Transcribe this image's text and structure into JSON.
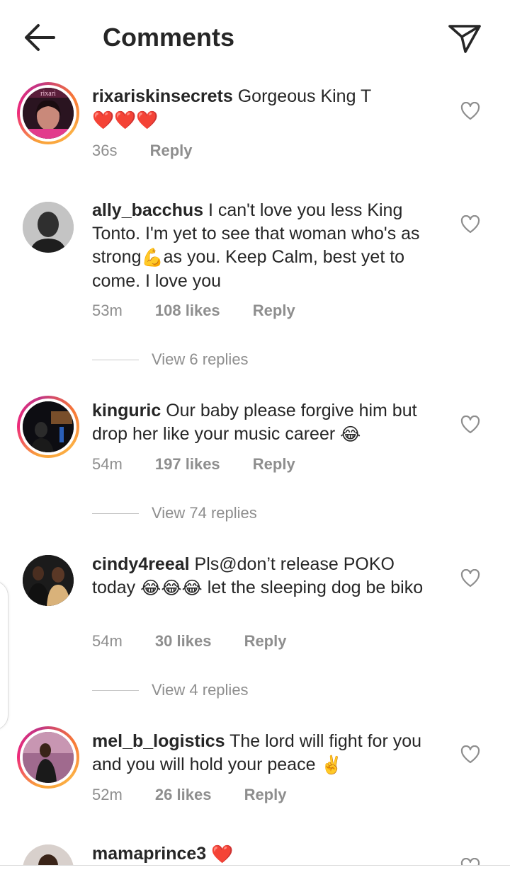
{
  "header": {
    "title": "Comments",
    "back_icon": "arrow-left-icon",
    "send_icon": "paper-plane-icon"
  },
  "colors": {
    "text": "#262626",
    "muted": "#8e8e8e",
    "heart": "#e0142b",
    "story_ring": "#ee2a7b"
  },
  "comments": [
    {
      "username": "rixariskinsecrets",
      "text": "Gorgeous King T",
      "emoji_suffix": "❤️❤️❤️",
      "time": "36s",
      "likes": "",
      "reply": "Reply",
      "avatar_label": "rixari"
    },
    {
      "username": "ally_bacchus",
      "text_a": "I can't love you less King Tonto. I'm yet to see that woman who's as strong",
      "emoji_mid": "💪",
      "text_b": "as you. Keep Calm, best yet to come. I love you",
      "time": "53m",
      "likes": "108 likes",
      "reply": "Reply",
      "view_replies": "View 6 replies"
    },
    {
      "username": "kinguric",
      "text": "Our baby please forgive him but drop her like your music career",
      "emoji_suffix": "😂",
      "time": "54m",
      "likes": "197 likes",
      "reply": "Reply",
      "view_replies": "View 74 replies"
    },
    {
      "username": "cindy4reeal",
      "text_a": "Pls@don’t release POKO today",
      "emoji_mid": "😂😂😂",
      "text_b": "let the sleeping dog be biko",
      "time": "54m",
      "likes": "30 likes",
      "reply": "Reply",
      "view_replies": "View 4 replies"
    },
    {
      "username": "mel_b_logistics",
      "text": "The lord will fight for you and you will hold your peace",
      "emoji_suffix": "✌️",
      "time": "52m",
      "likes": "26 likes",
      "reply": "Reply"
    },
    {
      "username": "mamaprince3",
      "emoji_suffix": "❤️"
    }
  ]
}
